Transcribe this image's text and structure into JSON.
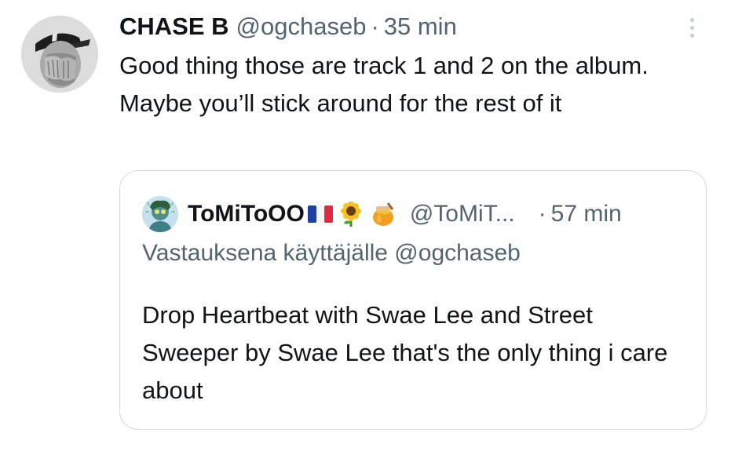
{
  "tweet": {
    "author": {
      "display_name": "CHASE B",
      "handle": "@ogchaseb"
    },
    "separator": "·",
    "timestamp": "35 min",
    "text": "Good thing those are track 1 and 2 on the album. Maybe you’ll stick around for the rest of it",
    "more_icon": "more-vertical-icon"
  },
  "quoted_tweet": {
    "author": {
      "display_name": "ToMiToOO",
      "handle": "@ToMiT...",
      "emojis": [
        "flag-france-icon",
        "sunflower-icon",
        "honey-pot-icon"
      ]
    },
    "separator": "·",
    "timestamp": "57 min",
    "reply_context": "Vastauksena käyttäjälle @ogchaseb",
    "text": "Drop Heartbeat with Swae Lee and Street Sweeper by Swae Lee that's the only thing i care about"
  },
  "colors": {
    "text_primary": "#0f1419",
    "text_secondary": "#536471",
    "border": "#cfd9de",
    "background": "#ffffff"
  }
}
